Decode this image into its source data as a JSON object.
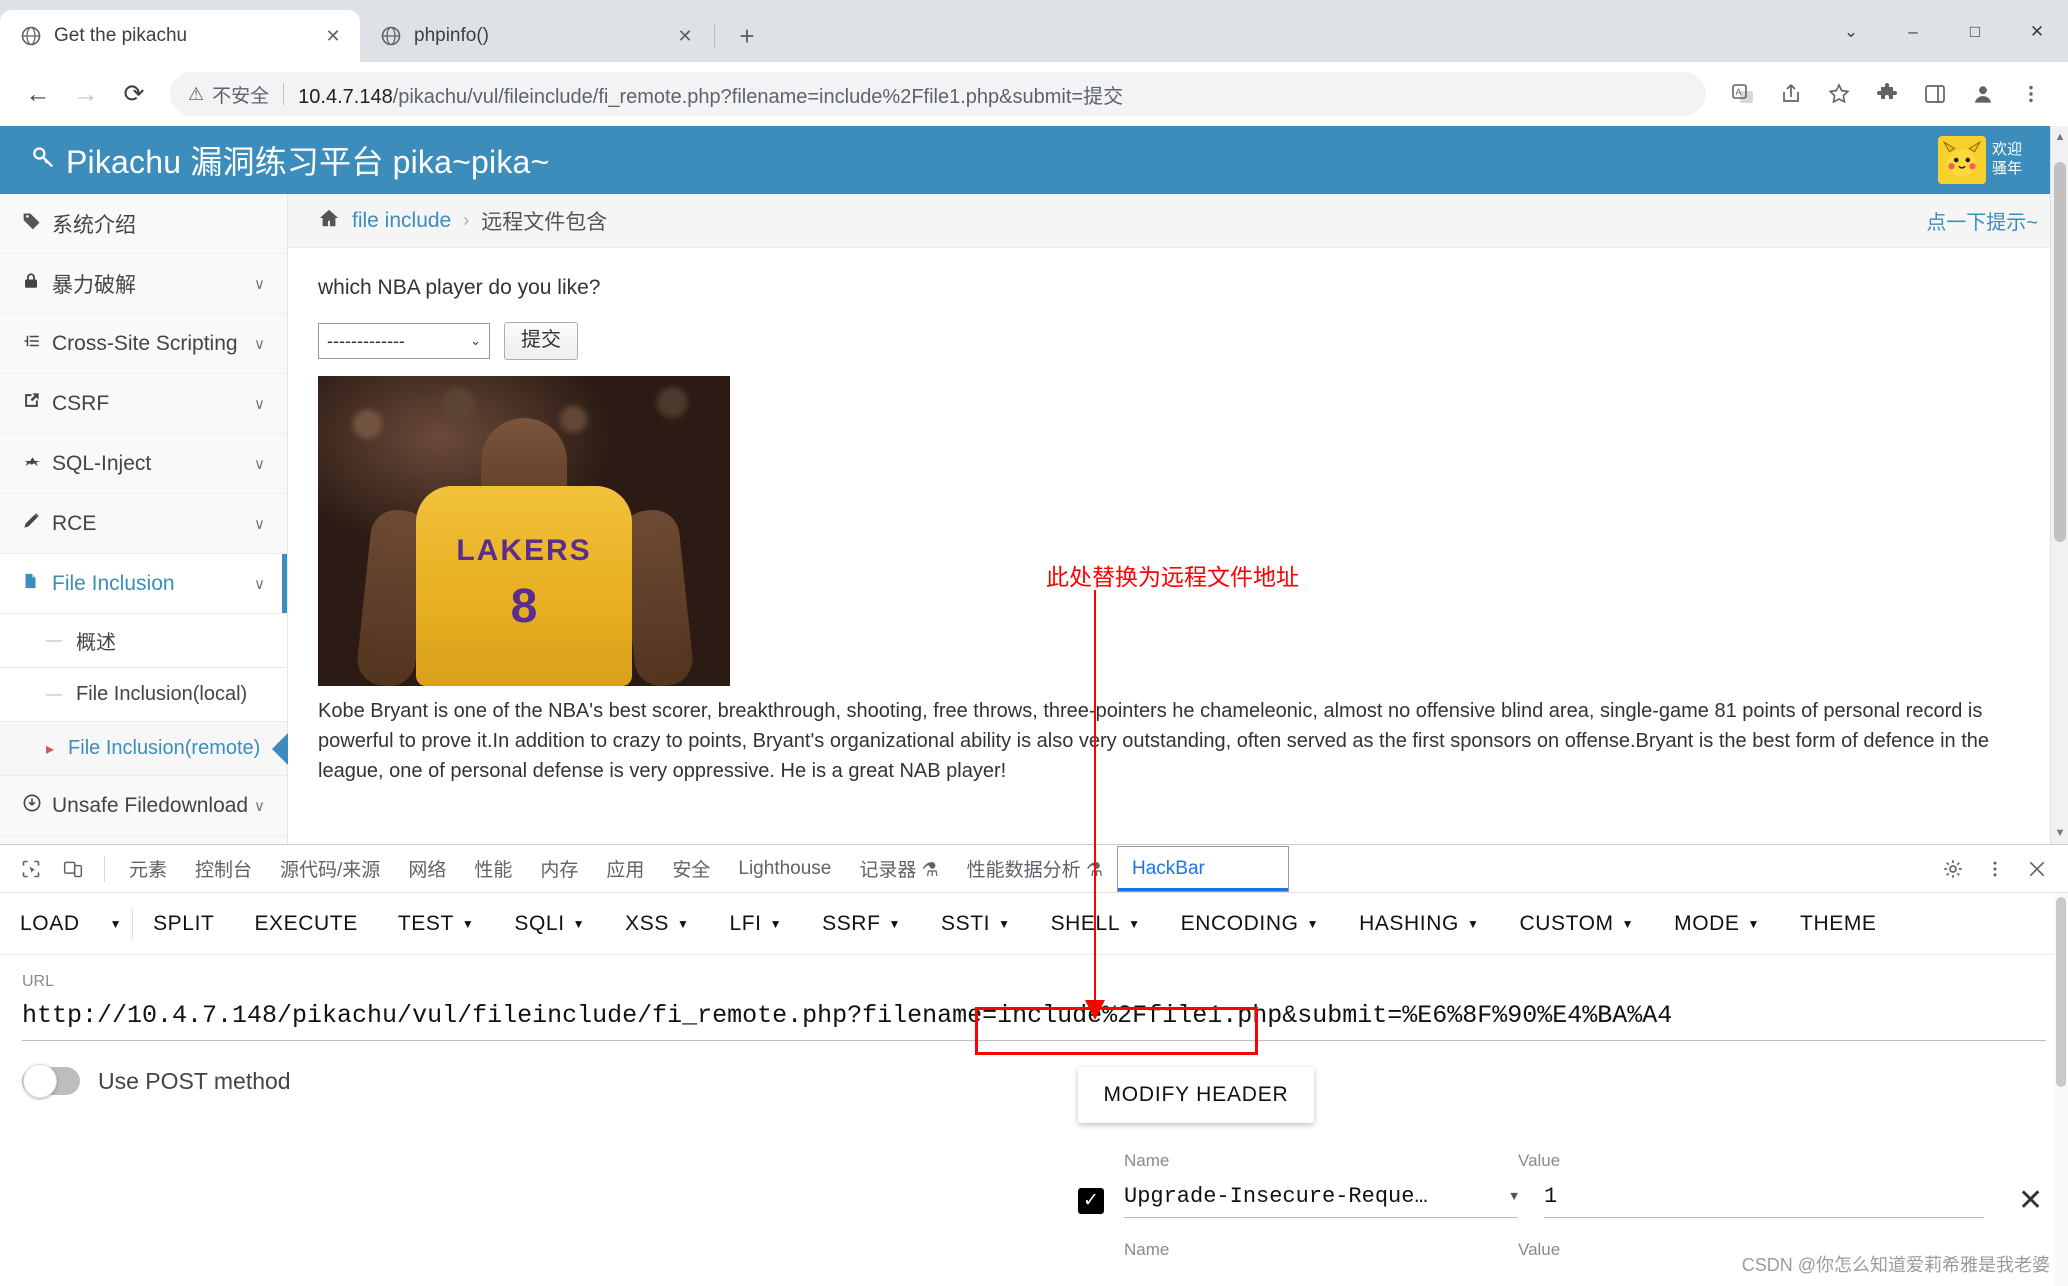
{
  "browser": {
    "tabs": [
      {
        "title": "Get the pikachu",
        "favicon": "globe-icon",
        "active": true,
        "close": "✕"
      },
      {
        "title": "phpinfo()",
        "favicon": "globe-icon",
        "active": false,
        "close": "✕"
      }
    ],
    "new_tab_label": "+",
    "window_controls": {
      "minimize": "–",
      "maximize": "□",
      "close": "✕",
      "more": "⌄"
    },
    "nav": {
      "back": "←",
      "forward": "→",
      "reload": "⟳"
    },
    "omnibox": {
      "warn_icon": "⚠",
      "warn_text": "不安全",
      "host": "10.4.7.148",
      "path": "/pikachu/vul/fileinclude/fi_remote.php?filename=include%2Ffile1.php&submit=提交"
    },
    "toolbar_icons": [
      "translate-icon",
      "share-icon",
      "bookmark-star-icon",
      "extensions-puzzle-icon",
      "sidepanel-icon",
      "profile-avatar-icon",
      "more-vertical-icon"
    ]
  },
  "pikachu": {
    "brand": "Pikachu 漏洞练习平台 pika~pika~",
    "brand_icon": "key-icon",
    "user": {
      "line1": "欢迎",
      "line2": "骚年",
      "avatar": "pikachu-avatar"
    },
    "sidebar": [
      {
        "label": "系统介绍",
        "icon": "tag-icon",
        "chevron": "",
        "active": false
      },
      {
        "label": "暴力破解",
        "icon": "lock-icon",
        "chevron": "∨",
        "active": false
      },
      {
        "label": "Cross-Site Scripting",
        "icon": "xss-icon",
        "chevron": "∨",
        "active": false
      },
      {
        "label": "CSRF",
        "icon": "external-link-icon",
        "chevron": "∨",
        "active": false
      },
      {
        "label": "SQL-Inject",
        "icon": "plane-icon",
        "chevron": "∨",
        "active": false
      },
      {
        "label": "RCE",
        "icon": "pencil-icon",
        "chevron": "∨",
        "active": false
      },
      {
        "label": "File Inclusion",
        "icon": "file-icon",
        "chevron": "∨",
        "active": true
      }
    ],
    "sub_items": [
      {
        "label": "概述",
        "marker": "—",
        "current": false
      },
      {
        "label": "File Inclusion(local)",
        "marker": "—",
        "current": false
      },
      {
        "label": "File Inclusion(remote)",
        "marker": "▸",
        "current": true
      }
    ],
    "sidebar_tail": [
      {
        "label": "Unsafe Filedownload",
        "icon": "download-circle-icon",
        "chevron": "∨",
        "active": false
      }
    ],
    "breadcrumb": {
      "home_icon": "home-icon",
      "link": "file include",
      "separator": "›",
      "current": "远程文件包含",
      "hint": "点一下提示~"
    },
    "question": "which NBA player do you like?",
    "select_value": "-------------",
    "select_caret": "⌄",
    "submit_label": "提交",
    "player_image": {
      "name": "kobe-bryant-photo",
      "jersey_text": "LAKERS",
      "jersey_number": "8"
    },
    "player_text": "Kobe Bryant is one of the NBA's best scorer, breakthrough, shooting, free throws, three-pointers he chameleonic, almost no offensive blind area, single-game 81 points of personal record is powerful to prove it.In addition to crazy to points, Bryant's organizational ability is also very outstanding, often served as the first sponsors on offense.Bryant is the best form of defence in the league, one of personal defense is very oppressive. He is a great NAB player!"
  },
  "annotation": {
    "text": "此处替换为远程文件地址",
    "color": "#ff0000"
  },
  "devtools": {
    "icons": [
      "inspect-element-icon",
      "device-toolbar-icon"
    ],
    "tabs": [
      {
        "label": "元素",
        "selected": false
      },
      {
        "label": "控制台",
        "selected": false
      },
      {
        "label": "源代码/来源",
        "selected": false
      },
      {
        "label": "网络",
        "selected": false
      },
      {
        "label": "性能",
        "selected": false
      },
      {
        "label": "内存",
        "selected": false
      },
      {
        "label": "应用",
        "selected": false
      },
      {
        "label": "安全",
        "selected": false
      },
      {
        "label": "Lighthouse",
        "selected": false
      },
      {
        "label": "记录器 ⚗",
        "selected": false
      },
      {
        "label": "性能数据分析 ⚗",
        "selected": false
      },
      {
        "label": "HackBar",
        "selected": true
      }
    ],
    "right_icons": [
      "gear-icon",
      "more-vertical-icon",
      "close-icon"
    ]
  },
  "hackbar": {
    "buttons": [
      {
        "label": "LOAD",
        "dropdown": true
      },
      {
        "label": "SPLIT",
        "dropdown": false
      },
      {
        "label": "EXECUTE",
        "dropdown": false
      },
      {
        "label": "TEST",
        "dropdown": true
      },
      {
        "label": "SQLI",
        "dropdown": true
      },
      {
        "label": "XSS",
        "dropdown": true
      },
      {
        "label": "LFI",
        "dropdown": true
      },
      {
        "label": "SSRF",
        "dropdown": true
      },
      {
        "label": "SSTI",
        "dropdown": true
      },
      {
        "label": "SHELL",
        "dropdown": true
      },
      {
        "label": "ENCODING",
        "dropdown": true
      },
      {
        "label": "HASHING",
        "dropdown": true
      },
      {
        "label": "CUSTOM",
        "dropdown": true
      },
      {
        "label": "MODE",
        "dropdown": true
      },
      {
        "label": "THEME",
        "dropdown": false
      }
    ],
    "url_label": "URL",
    "url_value": "http://10.4.7.148/pikachu/vul/fileinclude/fi_remote.php?filename=include%2Ffile1.php&submit=%E6%8F%90%E4%BA%A4",
    "post_toggle_label": "Use POST method",
    "post_toggle_on": false,
    "modify_header_label": "MODIFY HEADER",
    "header_columns": {
      "name": "Name",
      "value": "Value"
    },
    "headers": [
      {
        "checked": true,
        "check_glyph": "✓",
        "name": "Upgrade-Insecure-Reque…",
        "value": "1",
        "remove": "✕"
      }
    ],
    "empty_row_columns": {
      "name": "Name",
      "value": "Value"
    },
    "watermark": "CSDN @你怎么知道爱莉希雅是我老婆"
  }
}
